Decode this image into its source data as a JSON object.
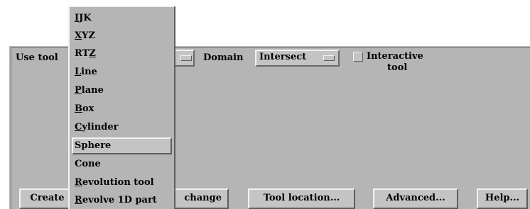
{
  "toolbar": {
    "use_tool_label": "Use tool",
    "domain_label": "Domain",
    "domain_value": "Intersect",
    "interactive_label_line1": "Interactive",
    "interactive_label_line2": "tool"
  },
  "menu": {
    "items": [
      {
        "pre": "",
        "mn": "I",
        "post": "JK"
      },
      {
        "pre": "",
        "mn": "X",
        "post": "YZ"
      },
      {
        "pre": "RT",
        "mn": "Z",
        "post": ""
      },
      {
        "pre": "",
        "mn": "L",
        "post": "ine"
      },
      {
        "pre": "",
        "mn": "P",
        "post": "lane"
      },
      {
        "pre": "",
        "mn": "B",
        "post": "ox"
      },
      {
        "pre": "",
        "mn": "C",
        "post": "ylinder"
      },
      {
        "pre": "",
        "mn": "",
        "post": "Sphere"
      },
      {
        "pre": "",
        "mn": "",
        "post": "Cone"
      },
      {
        "pre": "",
        "mn": "R",
        "post": "evolution tool"
      },
      {
        "pre": "",
        "mn": "R",
        "post": "evolve 1D part"
      }
    ],
    "selected_index": 7
  },
  "buttons": {
    "create": "Create",
    "change": "change",
    "tool_location": "Tool location...",
    "advanced": "Advanced...",
    "help": "Help..."
  }
}
